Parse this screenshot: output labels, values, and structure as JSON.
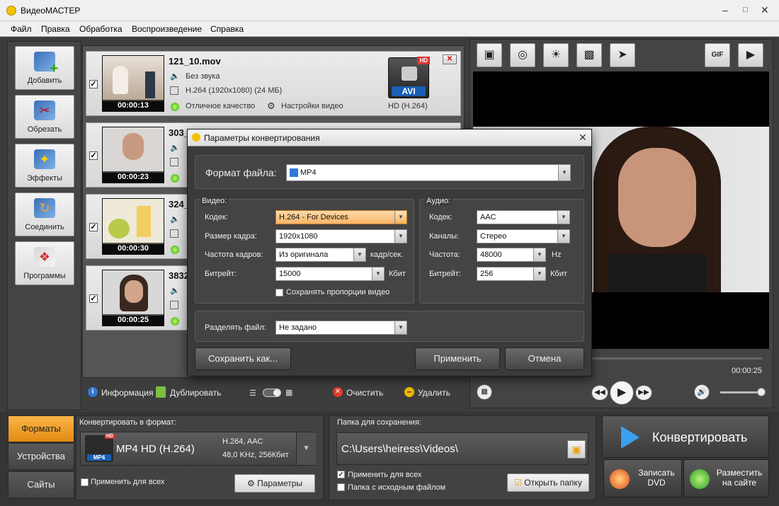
{
  "app": {
    "title": "ВидеоМАСТЕР"
  },
  "menu": [
    "Файл",
    "Правка",
    "Обработка",
    "Воспроизведение",
    "Справка"
  ],
  "sidebar": [
    {
      "label": "Добавить",
      "icon": "add-film-icon"
    },
    {
      "label": "Обрезать",
      "icon": "scissors-film-icon"
    },
    {
      "label": "Эффекты",
      "icon": "effects-wand-icon"
    },
    {
      "label": "Соединить",
      "icon": "join-film-icon"
    },
    {
      "label": "Программы",
      "icon": "programs-icon"
    }
  ],
  "files": [
    {
      "name": "121_10.mov",
      "audio": "Без звука",
      "codec": "H.264 (1920x1080) (24 МБ)",
      "quality": "Отличное качество",
      "settings": "Настройки видео",
      "duration": "00:00:13",
      "format_badge": "AVI",
      "hd_badge": "HD",
      "format_info": "HD (H.264)",
      "checked": true
    },
    {
      "name": "303_",
      "duration": "00:00:23",
      "checked": true
    },
    {
      "name": "324_",
      "duration": "00:00:30",
      "checked": true
    },
    {
      "name": "3832",
      "duration": "00:00:25",
      "checked": true
    }
  ],
  "list_toolbar": {
    "info": "Информация",
    "duplicate": "Дублировать",
    "clear": "Очистить",
    "delete": "Удалить"
  },
  "dialog": {
    "title": "Параметры конвертирования",
    "file_format_label": "Формат файла:",
    "file_format": "MP4",
    "video_section": "Видео:",
    "audio_section": "Аудио:",
    "video": {
      "codec_label": "Кодек:",
      "codec": "H.264 - For Devices",
      "frame_size_label": "Размер кадра:",
      "frame_size": "1920x1080",
      "fps_label": "Частота кадров:",
      "fps": "Из оригинала",
      "fps_unit": "кадр/сек.",
      "bitrate_label": "Битрейт:",
      "bitrate": "15000",
      "bitrate_unit": "Кбит",
      "keep_aspect": "Сохранять пропорции видео",
      "keep_aspect_checked": false
    },
    "audio": {
      "codec_label": "Кодек:",
      "codec": "AAC",
      "channels_label": "Каналы:",
      "channels": "Стерео",
      "freq_label": "Частота:",
      "freq": "48000",
      "freq_unit": "Hz",
      "bitrate_label": "Битрейт:",
      "bitrate": "256",
      "bitrate_unit": "Кбит"
    },
    "split_label": "Разделять файл:",
    "split_value": "Не задано",
    "save_as": "Сохранить как...",
    "apply": "Применить",
    "cancel": "Отмена"
  },
  "preview": {
    "time": "00:00:25",
    "volume_percent": 90,
    "seek_percent": 100
  },
  "bottom": {
    "tabs": [
      "Форматы",
      "Устройства",
      "Сайты"
    ],
    "active_tab": "Форматы",
    "convert_to_label": "Конвертировать в формат:",
    "format_name": "MP4 HD (H.264)",
    "format_icon_badge": "MP4",
    "format_hd": "HD",
    "format_spec1": "H.264, AAC",
    "format_spec2": "48,0 KHz, 256Кбит",
    "apply_all": "Применить для всех",
    "params": "Параметры",
    "save_folder_label": "Папка для сохранения:",
    "save_path": "C:\\Users\\heiress\\Videos\\",
    "apply_all2": "Применить для всех",
    "apply_all2_checked": true,
    "source_folder": "Папка с исходным файлом",
    "source_folder_checked": false,
    "open_folder": "Открыть папку",
    "convert": "Конвертировать",
    "dvd": "Записать DVD",
    "site": "Разместить на сайте"
  },
  "colors": {
    "accent_orange": "#f5a623",
    "dark_bg": "#3c3c3c"
  }
}
